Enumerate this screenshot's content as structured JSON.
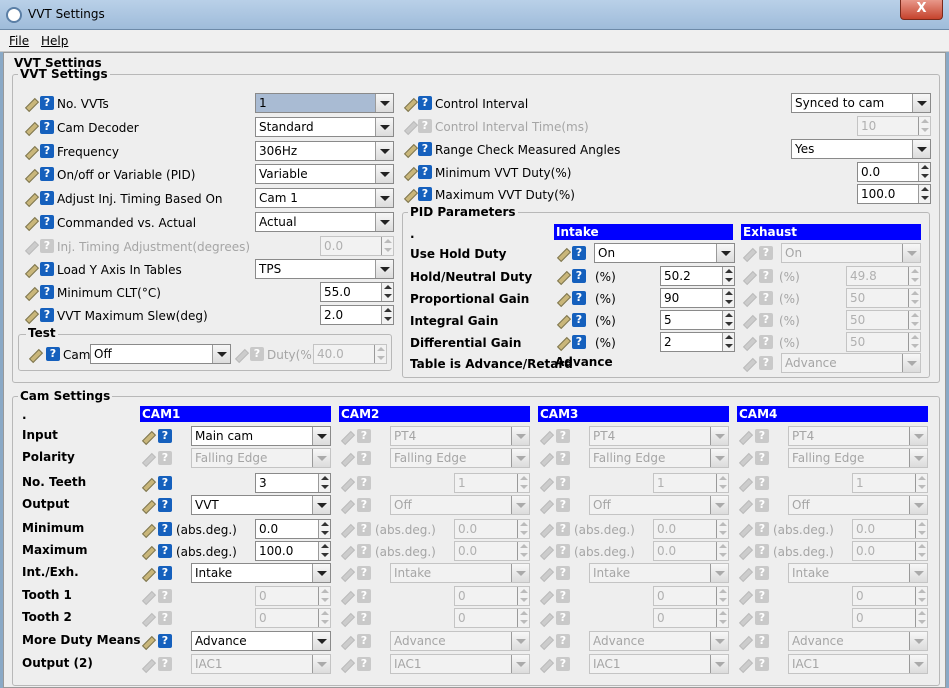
{
  "window": {
    "title": "VVT Settings",
    "close": "X"
  },
  "menu": {
    "file": "File",
    "help": "Help"
  },
  "main_title": "VVT Settings",
  "vvt": {
    "legend": "VVT Settings",
    "left": [
      {
        "label": "No. VVTs",
        "value": "1"
      },
      {
        "label": "Cam Decoder",
        "value": "Standard"
      },
      {
        "label": "Frequency",
        "value": "306Hz"
      },
      {
        "label": "On/off or Variable (PID)",
        "value": "Variable"
      },
      {
        "label": "Adjust Inj. Timing Based On",
        "value": "Cam 1"
      },
      {
        "label": "Commanded vs. Actual",
        "value": "Actual"
      },
      {
        "label": "Inj. Timing Adjustment(degrees)",
        "value": "0.0"
      },
      {
        "label": "Load Y Axis In Tables",
        "value": "TPS"
      },
      {
        "label": "Minimum CLT(°C)",
        "value": "55.0"
      },
      {
        "label": "VVT Maximum Slew(deg)",
        "value": "2.0"
      }
    ],
    "test": {
      "legend": "Test",
      "cam_label": "Cam",
      "cam_value": "Off",
      "duty_label": "Duty(%)",
      "duty_value": "40.0"
    },
    "right": [
      {
        "label": "Control Interval",
        "value": "Synced to cam"
      },
      {
        "label": "Control Interval Time(ms)",
        "value": "10"
      },
      {
        "label": "Range Check Measured Angles",
        "value": "Yes"
      },
      {
        "label": "Minimum VVT Duty(%)",
        "value": "0.0"
      },
      {
        "label": "Maximum VVT Duty(%)",
        "value": "100.0"
      }
    ],
    "pid": {
      "legend": "PID Parameters",
      "dot": ".",
      "intake_header": "Intake",
      "exhaust_header": "Exhaust",
      "rows": [
        {
          "label": "Use Hold Duty",
          "unit": "",
          "intake": "On",
          "exhaust": "On"
        },
        {
          "label": "Hold/Neutral Duty",
          "unit": "(%)",
          "intake": "50.2",
          "exhaust": "49.8"
        },
        {
          "label": "Proportional Gain",
          "unit": "(%)",
          "intake": "90",
          "exhaust": "50"
        },
        {
          "label": "Integral Gain",
          "unit": "(%)",
          "intake": "5",
          "exhaust": "50"
        },
        {
          "label": "Differential Gain",
          "unit": "(%)",
          "intake": "2",
          "exhaust": "50"
        },
        {
          "label": "Table is Advance/Retard",
          "unit": "",
          "intake": "Advance",
          "exhaust": "Advance"
        }
      ]
    }
  },
  "cam": {
    "legend": "Cam Settings",
    "dot": ".",
    "row_labels": [
      "Input",
      "Polarity",
      "No. Teeth",
      "Output",
      "Minimum",
      "Maximum",
      "Int./Exh.",
      "Tooth 1",
      "Tooth 2",
      "More Duty Means",
      "Output (2)"
    ],
    "unit": "(abs.deg.)",
    "cams": [
      {
        "name": "CAM1",
        "input": "Main cam",
        "polarity": "Falling Edge",
        "teeth": "3",
        "output": "VVT",
        "min": "0.0",
        "max": "100.0",
        "intexh": "Intake",
        "tooth1": "0",
        "tooth2": "0",
        "more": "Advance",
        "output2": "IAC1"
      },
      {
        "name": "CAM2",
        "input": "PT4",
        "polarity": "Falling Edge",
        "teeth": "1",
        "output": "Off",
        "min": "0.0",
        "max": "0.0",
        "intexh": "Intake",
        "tooth1": "0",
        "tooth2": "0",
        "more": "Advance",
        "output2": "IAC1"
      },
      {
        "name": "CAM3",
        "input": "PT4",
        "polarity": "Falling Edge",
        "teeth": "1",
        "output": "Off",
        "min": "0.0",
        "max": "0.0",
        "intexh": "Intake",
        "tooth1": "0",
        "tooth2": "0",
        "more": "Advance",
        "output2": "IAC1"
      },
      {
        "name": "CAM4",
        "input": "PT4",
        "polarity": "Falling Edge",
        "teeth": "1",
        "output": "Off",
        "min": "0.0",
        "max": "0.0",
        "intexh": "Intake",
        "tooth1": "0",
        "tooth2": "0",
        "more": "Advance",
        "output2": "IAC1"
      }
    ]
  },
  "icons": {
    "pencil": "pencil-icon",
    "help": "help-icon",
    "help_glyph": "?"
  },
  "colors": {
    "header_blue": "#0000ff",
    "help_blue": "#1560bd"
  }
}
